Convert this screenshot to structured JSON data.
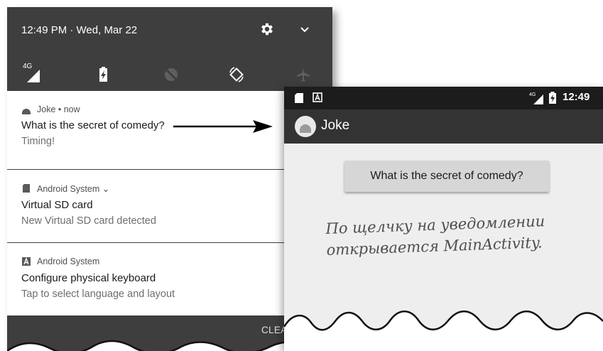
{
  "shade": {
    "status_time": "12:49 PM · Wed, Mar 22",
    "qs_network_label": "4G",
    "notifications": [
      {
        "app": "Joke • now",
        "title": "What is the secret of comedy?",
        "text": "Timing!",
        "icon": "android-head-icon"
      },
      {
        "app": "Android System ⌄",
        "title": "Virtual SD card",
        "text": "New Virtual SD card detected",
        "icon": "sd-card-icon"
      },
      {
        "app": "Android System",
        "title": "Configure physical keyboard",
        "text": "Tap to select language and layout",
        "icon": "keyboard-a-icon"
      }
    ],
    "clear_all": "CLEAR ALL"
  },
  "app": {
    "status_network_label": "4G",
    "status_time": "12:49",
    "title": "Joke",
    "button_label": "What is the secret of comedy?"
  },
  "annotation": {
    "line1": "По щелчку на уведомлении",
    "line2": "открывается MainActivity."
  },
  "colors": {
    "shade_bg": "#3e3e3e",
    "toolbar_bg": "#333333",
    "app_bg": "#eeeeee",
    "card_bg": "#ffffff"
  }
}
